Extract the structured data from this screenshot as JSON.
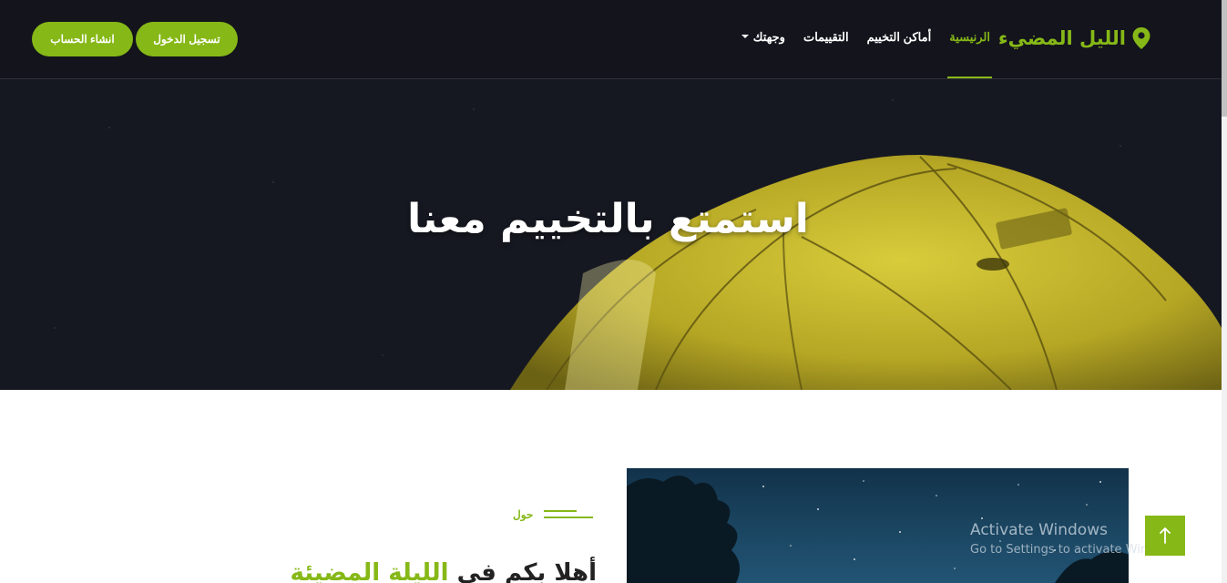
{
  "brand": {
    "name": "الليل المضيء",
    "icon": "map-marker-icon",
    "color": "#86b817"
  },
  "nav": {
    "items": [
      {
        "label": "الرنيسية",
        "active": true
      },
      {
        "label": "أماكن التخييم",
        "active": false
      },
      {
        "label": "التقييمات",
        "active": false
      },
      {
        "label": "وجهتك",
        "active": false,
        "dropdown": true
      }
    ],
    "login_button": "تسجيل الدخول",
    "register_button": "انشاء الحساب"
  },
  "hero": {
    "title": "استمتع بالتخييم معنا"
  },
  "about": {
    "tag": "حول",
    "heading_accent": "الليلة المضيئة",
    "heading_prefix": "أهلا بكم في"
  },
  "back_to_top": {
    "icon": "arrow-up-icon"
  },
  "watermark": {
    "line1": "Activate Windows",
    "line2": "Go to Settings to activate Windows."
  }
}
